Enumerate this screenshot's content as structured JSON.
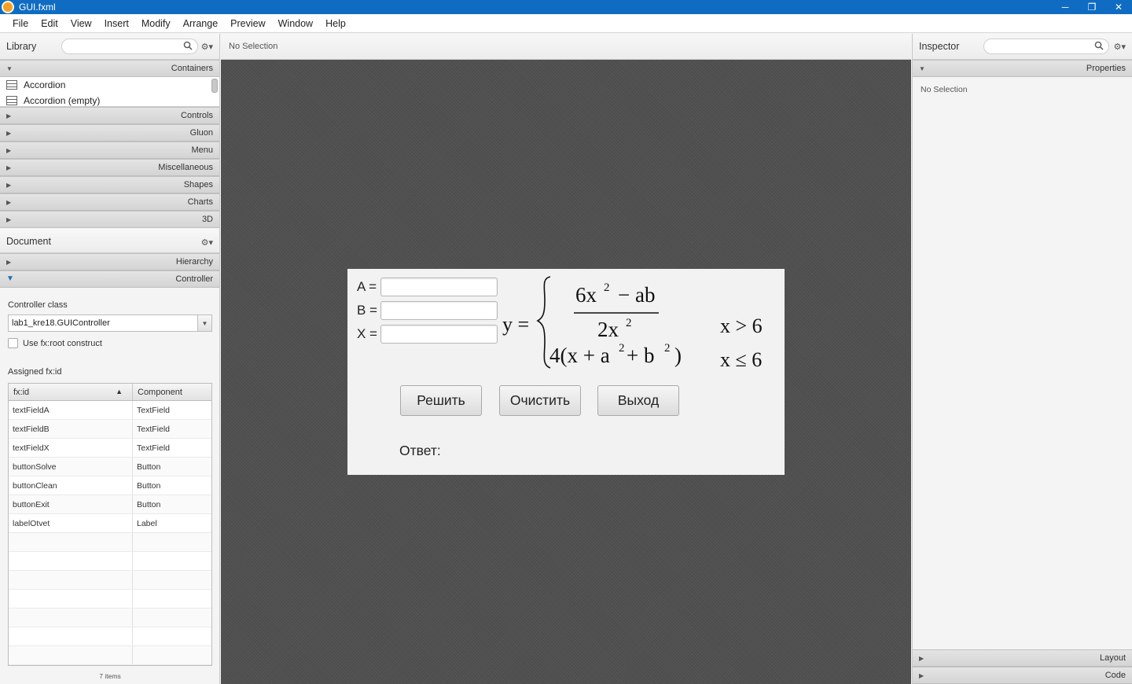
{
  "window": {
    "title": "GUI.fxml",
    "controls": [
      "─",
      "❐",
      "✕"
    ]
  },
  "menu": [
    "File",
    "Edit",
    "View",
    "Insert",
    "Modify",
    "Arrange",
    "Preview",
    "Window",
    "Help"
  ],
  "library": {
    "title": "Library",
    "sections": {
      "containers": "Containers",
      "rest": [
        "Controls",
        "Gluon",
        "Menu",
        "Miscellaneous",
        "Shapes",
        "Charts",
        "3D"
      ]
    },
    "items": [
      "Accordion",
      "Accordion  (empty)"
    ]
  },
  "document": {
    "title": "Document",
    "sections": [
      "Hierarchy",
      "Controller"
    ],
    "controller_class_label": "Controller class",
    "controller_class_value": "lab1_kre18.GUIController",
    "use_fxroot_label": "Use fx:root construct",
    "assigned_label": "Assigned fx:id",
    "table": {
      "headers": [
        "fx:id",
        "Component"
      ],
      "rows": [
        [
          "textFieldA",
          "TextField"
        ],
        [
          "textFieldB",
          "TextField"
        ],
        [
          "textFieldX",
          "TextField"
        ],
        [
          "buttonSolve",
          "Button"
        ],
        [
          "buttonClean",
          "Button"
        ],
        [
          "buttonExit",
          "Button"
        ],
        [
          "labelOtvet",
          "Label"
        ]
      ],
      "count": "7 items"
    }
  },
  "canvas": {
    "selection": "No Selection",
    "form": {
      "labels": {
        "a": "A =",
        "b": "B =",
        "x": "X ="
      },
      "buttons": {
        "solve": "Решить",
        "clear": "Очистить",
        "exit": "Выход"
      },
      "answer": "Ответ:",
      "formula": {
        "y": "y =",
        "num": "6x",
        "num_exp": "2",
        "num_rest": "− ab",
        "den": "2x",
        "den_exp": "2",
        "cond1": "x > 6",
        "expr2a": "4(x + a",
        "expr2_exp_a": "2",
        "expr2b": " + b",
        "expr2_exp_b": "2",
        "expr2c": ")",
        "cond2": "x ≤ 6"
      }
    }
  },
  "inspector": {
    "title": "Inspector",
    "sections": [
      "Properties",
      "Layout",
      "Code"
    ],
    "empty": "No Selection"
  }
}
